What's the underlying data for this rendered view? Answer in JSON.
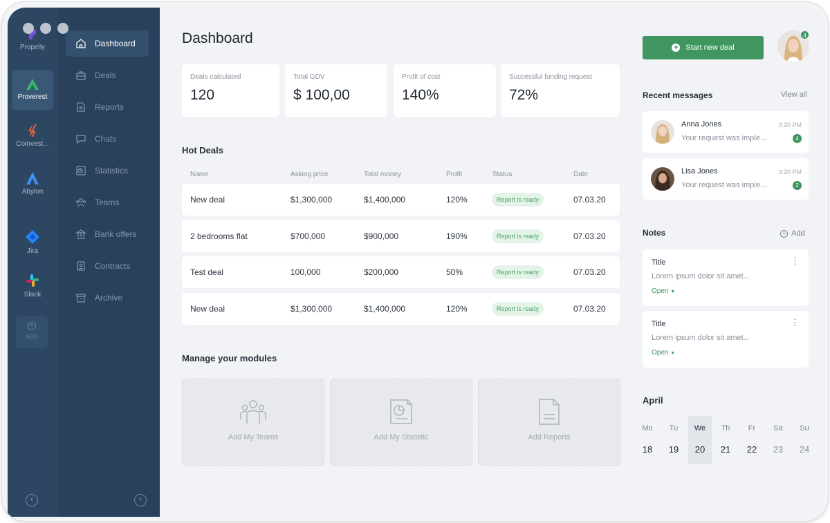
{
  "rail": {
    "items": [
      {
        "label": "Propelly"
      },
      {
        "label": "Proverest"
      },
      {
        "label": "Coinvest..."
      },
      {
        "label": "Abylon"
      },
      {
        "label": "Jira"
      },
      {
        "label": "Slack"
      }
    ],
    "add_label": "ADD"
  },
  "nav": {
    "items": [
      {
        "label": "Dashboard",
        "icon": "home-icon"
      },
      {
        "label": "Deals",
        "icon": "briefcase-icon"
      },
      {
        "label": "Reports",
        "icon": "document-icon"
      },
      {
        "label": "Chats",
        "icon": "chat-icon"
      },
      {
        "label": "Statistics",
        "icon": "statistics-icon"
      },
      {
        "label": "Teams",
        "icon": "teams-icon"
      },
      {
        "label": "Bank offers",
        "icon": "bank-icon"
      },
      {
        "label": "Contracts",
        "icon": "contract-icon"
      },
      {
        "label": "Archive",
        "icon": "archive-icon"
      }
    ]
  },
  "page": {
    "title": "Dashboard"
  },
  "stats": [
    {
      "label": "Deals calculated",
      "value": "120"
    },
    {
      "label": "Total GDV",
      "value": "$ 100,00"
    },
    {
      "label": "Profit of cost",
      "value": "140%"
    },
    {
      "label": "Successful funding request",
      "value": "72%"
    }
  ],
  "hot_deals": {
    "title": "Hot Deals",
    "columns": [
      "Name",
      "Asking price",
      "Total money",
      "Profit",
      "Status",
      "Date"
    ],
    "rows": [
      {
        "name": "New deal",
        "asking": "$1,300,000",
        "total": "$1,400,000",
        "profit": "120%",
        "status": "Report is ready",
        "date": "07.03.20"
      },
      {
        "name": "2 bedrooms flat",
        "asking": "$700,000",
        "total": "$900,000",
        "profit": "190%",
        "status": "Report is ready",
        "date": "07.03.20"
      },
      {
        "name": "Test deal",
        "asking": "100,000",
        "total": "$200,000",
        "profit": "50%",
        "status": "Report is ready",
        "date": "07.03.20"
      },
      {
        "name": "New deal",
        "asking": "$1,300,000",
        "total": "$1,400,000",
        "profit": "120%",
        "status": "Report is ready",
        "date": "07.03.20"
      }
    ]
  },
  "modules": {
    "title": "Manage your modules",
    "items": [
      {
        "label": "Add My Teams",
        "icon": "teams-icon"
      },
      {
        "label": "Add My Statistic",
        "icon": "statistic-chart-icon"
      },
      {
        "label": "Add Reports",
        "icon": "report-icon"
      }
    ]
  },
  "header": {
    "start_button": "Start new deal",
    "notification_count": "4"
  },
  "messages": {
    "title": "Recent messages",
    "view_all": "View all",
    "items": [
      {
        "name": "Anna Jones",
        "text": "Your request was imple...",
        "time": "3:20 PM",
        "count": "4"
      },
      {
        "name": "Lisa Jones",
        "text": "Your request was imple...",
        "time": "3:20 PM",
        "count": "2"
      }
    ]
  },
  "notes": {
    "title": "Notes",
    "add_label": "Add",
    "items": [
      {
        "title": "Title",
        "body": "Lorem ipsum dolor sit amet...",
        "open": "Open"
      },
      {
        "title": "Title",
        "body": "Lorem ipsum dolor sit amet...",
        "open": "Open"
      }
    ]
  },
  "calendar": {
    "month": "April",
    "days": [
      {
        "name": "Mo",
        "date": "18"
      },
      {
        "name": "Tu",
        "date": "19"
      },
      {
        "name": "We",
        "date": "20"
      },
      {
        "name": "Th",
        "date": "21"
      },
      {
        "name": "Fr",
        "date": "22"
      },
      {
        "name": "Sa",
        "date": "23"
      },
      {
        "name": "Su",
        "date": "24"
      }
    ],
    "selected": "20"
  },
  "colors": {
    "accent": "#3f9660",
    "rail": "#2d4763",
    "sidebar": "#2a415b",
    "status_bg": "#e4f3e8"
  }
}
